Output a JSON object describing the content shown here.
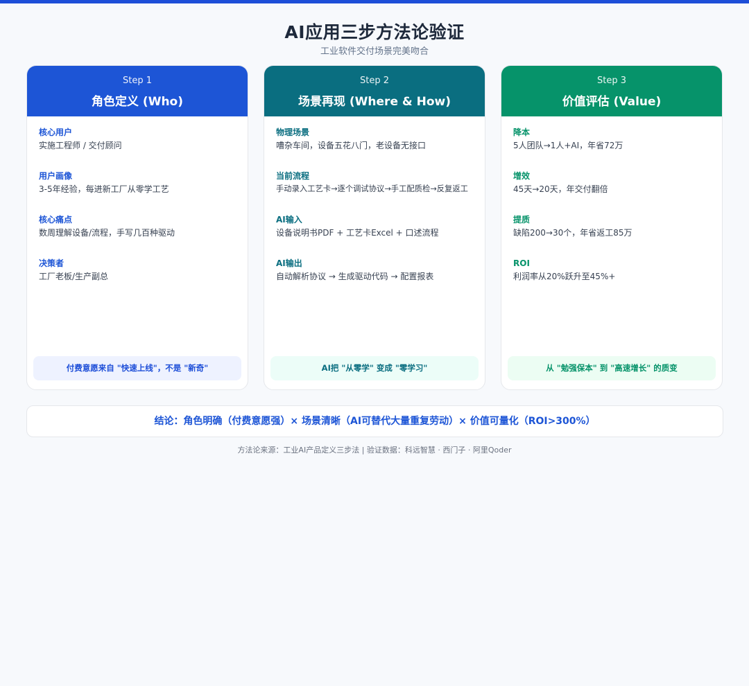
{
  "page": {
    "title": "AI应用三步方法论验证",
    "subtitle": "工业软件交付场景完美吻合"
  },
  "cards": [
    {
      "step": "Step 1",
      "title": "角色定义 (Who)",
      "items": [
        {
          "label": "核心用户",
          "text": "实施工程师 / 交付顾问"
        },
        {
          "label": "用户画像",
          "text": "3-5年经验，每进新工厂从零学工艺"
        },
        {
          "label": "核心痛点",
          "text": "数周理解设备/流程，手写几百种驱动"
        },
        {
          "label": "决策者",
          "text": "工厂老板/生产副总"
        }
      ],
      "footer": "付费意愿来自 \"快速上线\"，不是 \"新奇\""
    },
    {
      "step": "Step 2",
      "title": "场景再现 (Where & How)",
      "items": [
        {
          "label": "物理场景",
          "text": "嘈杂车间，设备五花八门，老设备无接口"
        },
        {
          "label": "当前流程",
          "text": "手动录入工艺卡→逐个调试协议→手工配质检→反复返工"
        },
        {
          "label": "AI输入",
          "text": "设备说明书PDF + 工艺卡Excel + 口述流程"
        },
        {
          "label": "AI输出",
          "text": "自动解析协议 → 生成驱动代码 → 配置报表"
        }
      ],
      "footer": "AI把 \"从零学\" 变成 \"零学习\""
    },
    {
      "step": "Step 3",
      "title": "价值评估 (Value)",
      "items": [
        {
          "label": "降本",
          "text": "5人团队→1人+AI，年省72万"
        },
        {
          "label": "增效",
          "text": "45天→20天，年交付翻倍"
        },
        {
          "label": "提质",
          "text": "缺陷200→30个，年省返工85万"
        },
        {
          "label": "ROI",
          "text": "利润率从20%跃升至45%+"
        }
      ],
      "footer": "从 \"勉强保本\" 到 \"高速增长\" 的质变"
    }
  ],
  "conclusion": "结论：角色明确（付费意愿强）× 场景清晰（AI可替代大量重复劳动）× 价值可量化（ROI>300%）",
  "source": "方法论来源：工业AI产品定义三步法 | 验证数据：科远智慧 · 西门子 · 阿里Qoder",
  "colors": {
    "step1": "#1d55d6",
    "step2": "#0a6e80",
    "step3": "#06936a",
    "topbar": "#1d4ed8"
  }
}
